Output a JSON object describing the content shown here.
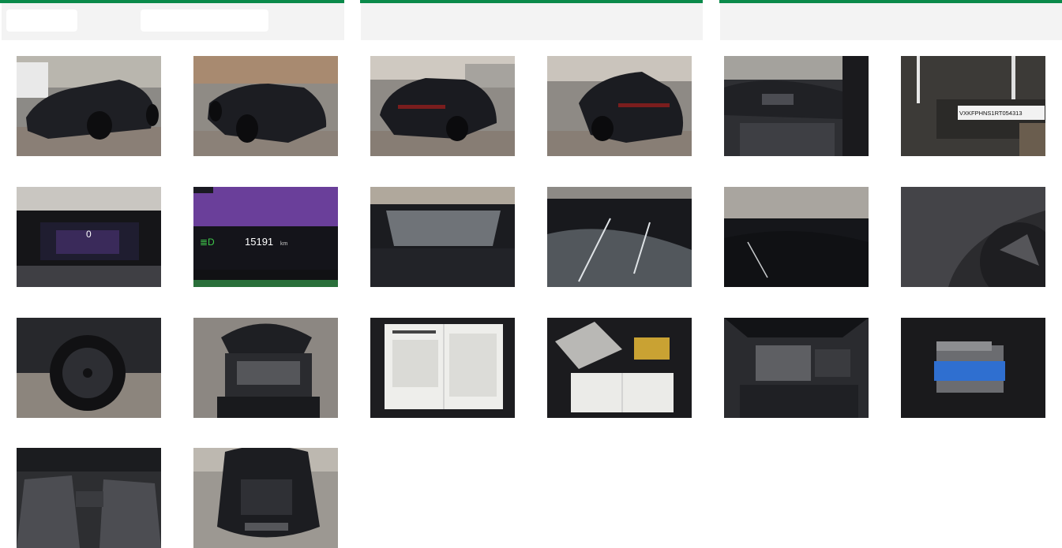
{
  "colors": {
    "accent": "#0a8a4a",
    "panel": "#f3f3f3"
  },
  "header": {
    "pill_1": "",
    "pill_2": ""
  },
  "gallery": {
    "photos": [
      {
        "name": "front-left-exterior-photo"
      },
      {
        "name": "front-right-exterior-photo"
      },
      {
        "name": "rear-left-exterior-photo"
      },
      {
        "name": "rear-right-exterior-photo"
      },
      {
        "name": "interior-dashboard-photo"
      },
      {
        "name": "vin-plate-photo"
      },
      {
        "name": "instrument-cluster-photo"
      },
      {
        "name": "odometer-photo"
      },
      {
        "name": "windshield-photo"
      },
      {
        "name": "roof-photo"
      },
      {
        "name": "roof-rear-photo"
      },
      {
        "name": "tire-sidewall-photo"
      },
      {
        "name": "wheel-photo"
      },
      {
        "name": "engine-bay-open-hood-photo"
      },
      {
        "name": "service-book-photo"
      },
      {
        "name": "documents-photo"
      },
      {
        "name": "engine-photo"
      },
      {
        "name": "trunk-accessories-photo"
      },
      {
        "name": "rear-seats-photo"
      },
      {
        "name": "open-trunk-photo"
      }
    ]
  },
  "overlays": {
    "vin_text": "VXKFPHNS1RT054313",
    "odometer_value": "15191",
    "odometer_unit": "km",
    "cluster_speed": "0"
  }
}
